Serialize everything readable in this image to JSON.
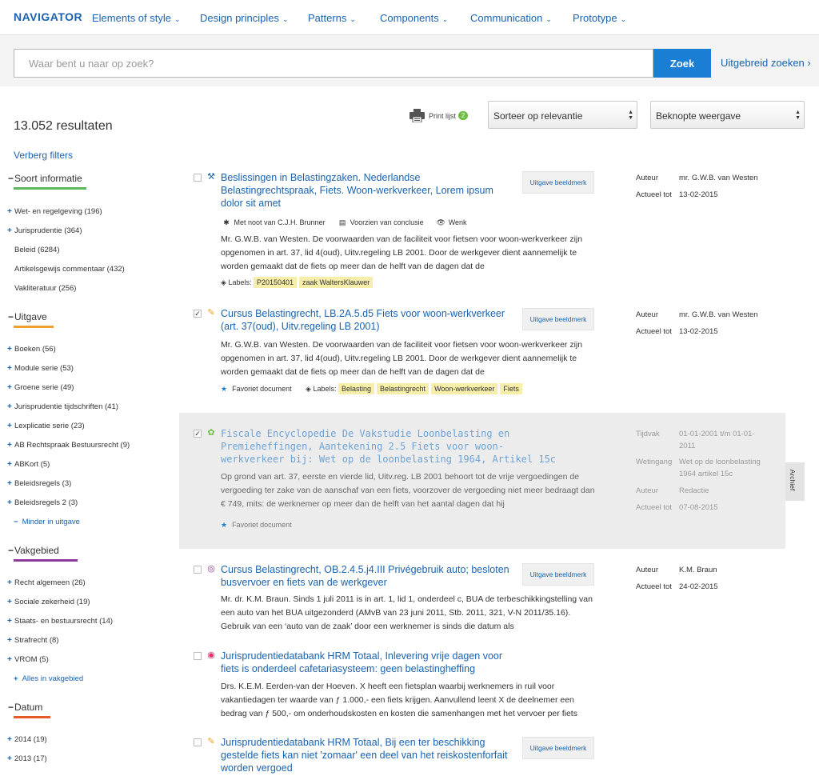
{
  "header": {
    "logo": "NAVIGATOR",
    "nav": [
      {
        "label": "Elements of style"
      },
      {
        "label": "Design principles"
      },
      {
        "label": "Patterns"
      },
      {
        "label": "Components"
      },
      {
        "label": "Communication"
      },
      {
        "label": "Prototype"
      }
    ],
    "chevron": "⌄"
  },
  "search": {
    "placeholder": "Waar bent u naar op zoek?",
    "value": "",
    "button": "Zoek",
    "advanced": "Uitgebreid zoeken ›"
  },
  "toolbar": {
    "results_count": "13.052 resultaten",
    "print_label": "Print lijst",
    "print_count": "2",
    "sort_value": "Sorteer op relevantie",
    "view_value": "Beknopte weergave"
  },
  "sidebar": {
    "hide_filters": "Verberg filters",
    "facets": [
      {
        "title": "Soort informatie",
        "color": "#5cb85c",
        "items": [
          "Wet- en regelgeving (196)",
          "Jurisprudentie (364)",
          "Beleid (6284)",
          "Artikelsgewijs commentaar (432)",
          "Vakliteratuur (256)"
        ]
      },
      {
        "title": "Uitgave",
        "color": "#f0a030",
        "items": [
          "Boeken (56)",
          "Module serie (53)",
          "Groene serie (49)",
          "Jurisprudentie tijdschriften (41)",
          "Lexplicatie serie (23)",
          "AB Rechtspraak Bestuursrecht (9)",
          "ABKort (5)",
          "Beleidsregels (3)",
          "Beleidsregels 2 (3)"
        ],
        "more": "Minder in uitgave",
        "more_sym": "−"
      },
      {
        "title": "Vakgebied",
        "color": "#8e3a9c",
        "items": [
          "Recht algemeen (26)",
          "Sociale zekerheid (19)",
          "Staats- en bestuursrecht (14)",
          "Strafrecht (8)",
          "VROM (5)"
        ],
        "more": "Alles in vakgebied",
        "more_sym": "+"
      },
      {
        "title": "Datum",
        "color": "#e65a28",
        "items": [
          "2014 (19)",
          "2013 (17)"
        ]
      }
    ]
  },
  "results": [
    {
      "title": "Beslissingen in Belastingzaken. Nederlandse Belastingrechtspraak, Fiets. Woon-werkverkeer, Lorem ipsum dolor sit amet",
      "type_icon": "hammer-icon",
      "type_glyph": "⚒",
      "type_color": "#1a63b0",
      "checked": "",
      "button": "Uitgave beeldmerk",
      "meta": [
        {
          "k": "Auteur",
          "v": "mr. G.W.B. van Westen"
        },
        {
          "k": "Actueel tot",
          "v": "13-02-2015"
        }
      ],
      "notes": [
        "Met noot van C.J.H. Brunner",
        "Voorzien van conclusie",
        "Wenk"
      ],
      "snippet": "Mr. G.W.B. van Westen. De voorwaarden van de faciliteit voor fietsen voor woon-werkverkeer zijn opgenomen in art. 37, lid 4(oud), Uitv.regeling LB 2001. Door de werkgever dient aannemelijk te worden gemaakt dat de fiets op meer dan de helft van de dagen dat de",
      "labels_label": "Labels:",
      "labels": [
        "P20150401",
        "zaak WaltersKlauwer"
      ]
    },
    {
      "title": "Cursus Belastingrecht, LB.2A.5.d5 Fiets voor woon-werkverkeer (art. 37(oud), Uitv.regeling LB 2001)",
      "type_icon": "pencil-icon",
      "type_glyph": "✎",
      "type_color": "#e8a020",
      "checked": "✓",
      "button": "Uitgave beeldmerk",
      "meta": [
        {
          "k": "Auteur",
          "v": "mr. G.W.B. van Westen"
        },
        {
          "k": "Actueel tot",
          "v": "13-02-2015"
        }
      ],
      "snippet": "Mr. G.W.B. van Westen. De voorwaarden van de faciliteit voor fietsen voor woon-werkverkeer zijn opgenomen in art. 37, lid 4(oud), Uitv.regeling LB 2001. Door de werkgever dient aannemelijk te worden gemaakt dat de fiets op meer dan de helft van de dagen dat de",
      "favorite": "Favoriet document",
      "labels_label": "Labels:",
      "labels": [
        "Belasting",
        "Belastingrecht",
        "Woon-werkverkeer",
        "Fiets"
      ]
    },
    {
      "title": "Fiscale Encyclopedie De Vakstudie Loonbelasting en Premieheffingen, Aantekening 2.5 Fiets voor woon-werkverkeer bij: Wet op de loonbelasting 1964, Artikel 15c",
      "type_icon": "flower-icon",
      "type_glyph": "✿",
      "type_color": "#6cbf40",
      "checked": "✓",
      "meta": [
        {
          "k": "Tijdvak",
          "v": "01-01-2001 t/m 01-01-2011"
        },
        {
          "k": "Wetingang",
          "v": "Wet op de loonbelasting 1964 artikel 15c"
        },
        {
          "k": "Auteur",
          "v": "Redactie"
        },
        {
          "k": "Actueel tot",
          "v": "07-08-2015"
        }
      ],
      "snippet": "Op grond van art. 37, eerste en vierde lid, Uitv.reg. LB 2001 behoort tot de vrije vergoedingen de vergoeding ter zake van de aanschaf van een fiets, voorzover de vergoeding niet meer bedraagt dan € 749, mits: de werknemer op meer dan de helft van het aantal dagen dat hij",
      "favorite": "Favoriet document",
      "archive": "Archief"
    },
    {
      "title": "Cursus Belastingrecht, OB.2.4.5.j4.III Privégebruik auto; besloten busvervoer en fiets van de werkgever",
      "type_icon": "check-circle-icon",
      "type_glyph": "◎",
      "type_color": "#8e3a9c",
      "checked": "",
      "button": "Uitgave beeldmerk",
      "meta": [
        {
          "k": "Auteur",
          "v": "K.M. Braun"
        },
        {
          "k": "Actueel tot",
          "v": "24-02-2015"
        }
      ],
      "snippet": "Mr. dr. K.M. Braun. Sinds 1 juli 2011 is in art. 1, lid 1, onderdeel c, BUA de terbeschikkingstelling van een auto van het BUA uitgezonderd (AMvB van 23 juni 2011, Stb. 2011, 321, V-N 2011/35.16). Gebruik van een ‘auto van de zaak’ door een werknemer is sinds die datum als"
    },
    {
      "title": "Jurisprudentiedatabank HRM Totaal, Inlevering vrije dagen voor fiets is onderdeel cafetariasysteem: geen belastingheffing",
      "type_icon": "eye-icon",
      "type_glyph": "◉",
      "type_color": "#e0306a",
      "checked": "",
      "snippet": "Drs. K.E.M. Eerden-van der Hoeven. X heeft een fietsplan waarbij werknemers in ruil voor vakantiedagen ter waarde van ƒ 1.000,- een fiets krijgen. Aanvullend leent X de deelnemer een bedrag van ƒ 500,- om onderhoudskosten en kosten die samenhangen met het vervoer per fiets"
    },
    {
      "title": "Jurisprudentiedatabank HRM Totaal, Bij een ter beschikking gestelde fiets kan niet 'zomaar' een deel van het reiskostenforfait worden vergoed",
      "type_icon": "pencil-icon",
      "type_glyph": "✎",
      "type_color": "#e8a020",
      "checked": "",
      "button": "Uitgave beeldmerk"
    }
  ]
}
